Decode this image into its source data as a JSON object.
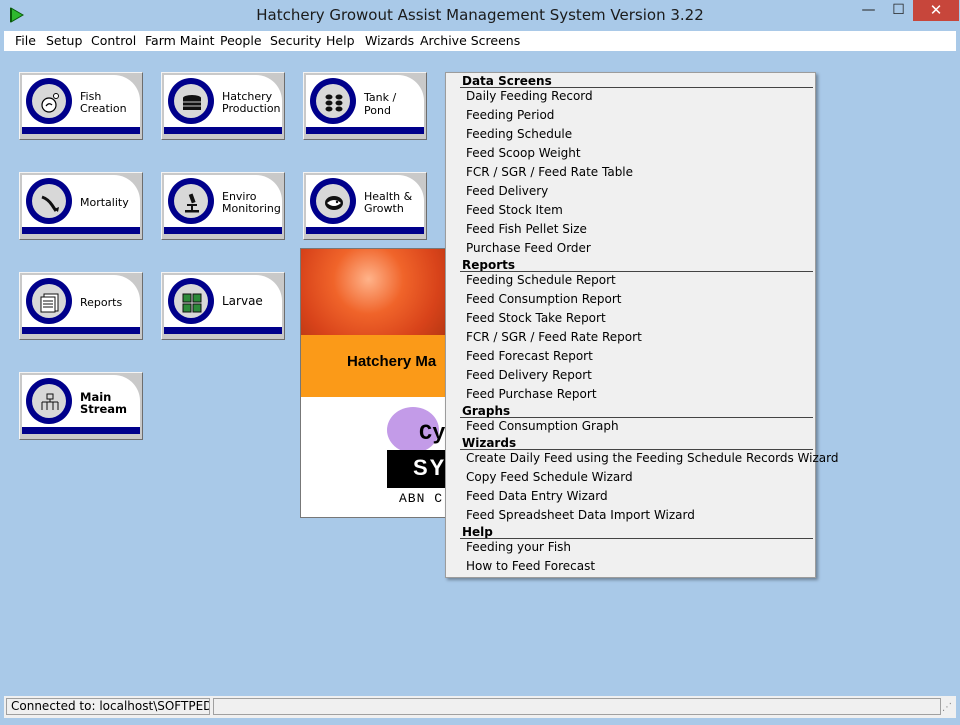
{
  "window": {
    "title": "Hatchery Growout Assist Management System Version 3.22",
    "minimize": "—",
    "maximize": "☐",
    "close": "✕"
  },
  "menu": [
    "File",
    "Setup",
    "Control",
    "Farm Maint",
    "People",
    "Security",
    "Help",
    "Wizards",
    "Archive Screens"
  ],
  "tiles": [
    {
      "label": "Fish Creation",
      "icon": "fish-egg-icon"
    },
    {
      "label": "Hatchery Production",
      "icon": "hatchery-tank-icon"
    },
    {
      "label": "Tank / Pond",
      "icon": "tank-pond-icon"
    },
    {
      "label": "Mortality",
      "icon": "dead-fish-icon"
    },
    {
      "label": "Enviro Monitoring",
      "icon": "microscope-icon"
    },
    {
      "label": "Health & Growth",
      "icon": "healthy-fish-icon"
    },
    {
      "label": "Reports",
      "icon": "report-document-icon"
    },
    {
      "label": "Larvae",
      "icon": "larvae-icon"
    },
    {
      "label": "Main Stream",
      "icon": "org-chart-icon"
    }
  ],
  "splash": {
    "title": "Hatchery Ma",
    "logo_letter": "Cy",
    "logo_bar_text": "SY",
    "abn": "ABN C"
  },
  "dropdown": {
    "data_screens": {
      "title": "Data Screens",
      "items": [
        "Daily Feeding Record",
        "Feeding Period",
        "Feeding Schedule",
        "Feed Scoop Weight",
        "FCR / SGR / Feed Rate Table",
        "Feed Delivery",
        "Feed Stock Item",
        "Feed Fish Pellet Size",
        "Purchase Feed Order"
      ]
    },
    "reports": {
      "title": "Reports",
      "items": [
        "Feeding Schedule Report",
        "Feed Consumption Report",
        "Feed Stock Take Report",
        "FCR / SGR / Feed Rate Report",
        "Feed Forecast Report",
        "Feed Delivery Report",
        "Feed Purchase Report"
      ]
    },
    "graphs": {
      "title": "Graphs",
      "items": [
        "Feed Consumption Graph"
      ]
    },
    "wizards": {
      "title": "Wizards",
      "items": [
        "Create Daily Feed using the Feeding Schedule Records Wizard",
        "Copy Feed Schedule Wizard",
        "Feed Data Entry Wizard",
        "Feed Spreadsheet Data Import Wizard"
      ]
    },
    "help": {
      "title": "Help",
      "items": [
        "Feeding your Fish",
        "How to Feed Forecast"
      ]
    }
  },
  "status": {
    "connection": "Connected to: localhost\\SOFTPEDIAS"
  },
  "colors": {
    "background": "#a9c9e8",
    "tile_band": "#00008b",
    "close_button": "#c7463b",
    "splash_orange": "#fb9a18"
  }
}
